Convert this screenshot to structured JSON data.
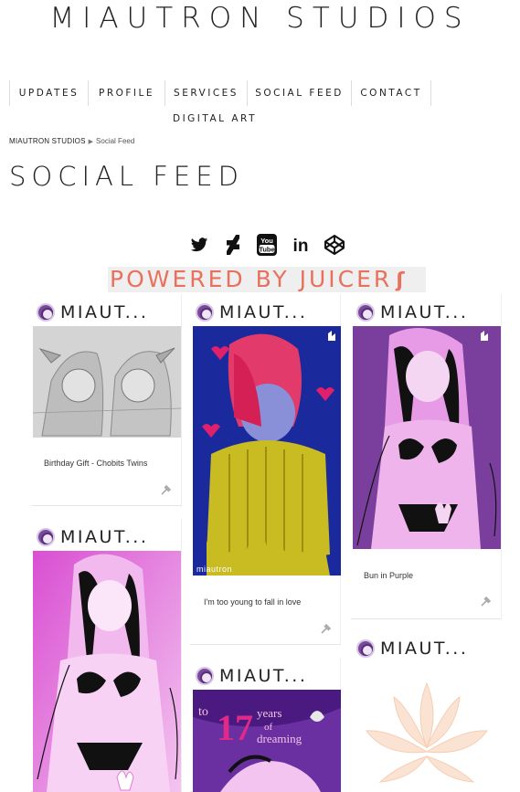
{
  "site": {
    "title": "MIAUTRON STUDIOS"
  },
  "nav": {
    "items": [
      {
        "label": "UPDATES"
      },
      {
        "label": "PROFILE"
      },
      {
        "label": "SERVICES"
      },
      {
        "label": "SOCIAL FEED"
      },
      {
        "label": "CONTACT"
      },
      {
        "label": "DIGITAL ART"
      }
    ]
  },
  "breadcrumb": {
    "home": "MIAUTRON STUDIOS",
    "separator": "▶",
    "current": "Social Feed"
  },
  "page": {
    "title": "SOCIAL FEED"
  },
  "socials": [
    {
      "icon": "twitter-icon"
    },
    {
      "icon": "deviantart-icon"
    },
    {
      "icon": "youtube-icon",
      "text": "You\nTube"
    },
    {
      "icon": "linkedin-icon",
      "text": "in"
    },
    {
      "icon": "codepen-icon"
    }
  ],
  "powered": {
    "label": "POWERED BY JUICER",
    "accent": "#e8715e"
  },
  "feed": {
    "posts": [
      {
        "author": "MIAUT...",
        "caption": "Birthday Gift - Chobits Twins"
      },
      {
        "author": "MIAUT...",
        "caption": "I'm too young to fall in love",
        "watermark": "miautron"
      },
      {
        "author": "MIAUT...",
        "caption": "Bun in Purple"
      },
      {
        "author": "MIAUT...",
        "caption": ""
      },
      {
        "author": "MIAUT...",
        "caption": "",
        "art_text": [
          "to",
          "17",
          "years",
          "of",
          "dreaming"
        ]
      },
      {
        "author": "MIAUT...",
        "caption": ""
      }
    ]
  },
  "colors": {
    "purple": "#7a3f9c",
    "navy": "#1a2a9c",
    "magenta": "#e27ad6",
    "olive": "#c9bb22"
  }
}
